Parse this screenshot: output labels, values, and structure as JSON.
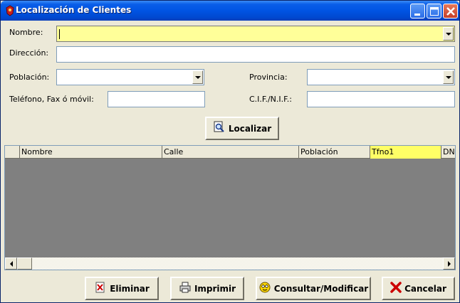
{
  "window": {
    "title": "Localización de Clientes",
    "icon": "app-icon",
    "controls": [
      "minimize-icon",
      "maximize-icon",
      "close-icon"
    ]
  },
  "form": {
    "nombre_label": "Nombre:",
    "nombre_value": "",
    "direccion_label": "Dirección:",
    "direccion_value": "",
    "poblacion_label": "Población:",
    "poblacion_value": "",
    "provincia_label": "Provincia:",
    "provincia_value": "",
    "telefono_label": "Teléfono, Fax ó móvil:",
    "telefono_value": "",
    "cif_label": "C.I.F./N.I.F.:",
    "cif_value": "",
    "localizar_label": "Localizar"
  },
  "grid": {
    "columns": [
      "Nombre",
      "Calle",
      "Población",
      "Tfno1",
      "DNI"
    ],
    "active_column": "Tfno1",
    "rows": []
  },
  "actions": {
    "eliminar": "Eliminar",
    "imprimir": "Imprimir",
    "consultar": "Consultar/Modificar",
    "cancelar": "Cancelar"
  },
  "colors": {
    "title_bar": "#0054e3",
    "focused_field": "#ffff99",
    "active_column": "#ffff66",
    "grid_background": "#808080"
  }
}
